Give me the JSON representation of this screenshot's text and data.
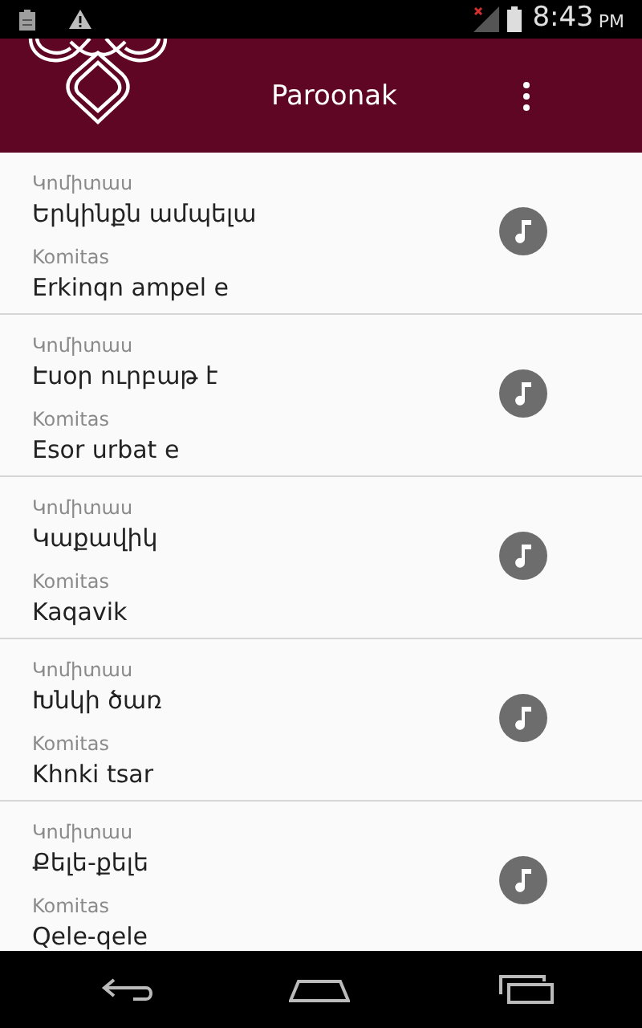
{
  "status_bar": {
    "time": "8:43",
    "ampm": "PM"
  },
  "toolbar": {
    "title": "Paroonak"
  },
  "songs": [
    {
      "composer_hy": "Կոմիտաս",
      "title_hy": "Երկինքն ամպելա",
      "composer": "Komitas",
      "title": "Erkinqn ampel e"
    },
    {
      "composer_hy": "Կոմիտաս",
      "title_hy": "Էսօր ուրբաթ է",
      "composer": "Komitas",
      "title": "Esor urbat e"
    },
    {
      "composer_hy": "Կոմիտաս",
      "title_hy": "Կաքավիկ",
      "composer": "Komitas",
      "title": "Kaqavik"
    },
    {
      "composer_hy": "Կոմիտաս",
      "title_hy": "Խնկի ծառ",
      "composer": "Komitas",
      "title": "Khnki tsar"
    },
    {
      "composer_hy": "Կոմիտաս",
      "title_hy": "Քելե-քելե",
      "composer": "Komitas",
      "title": "Qele-qele"
    }
  ]
}
